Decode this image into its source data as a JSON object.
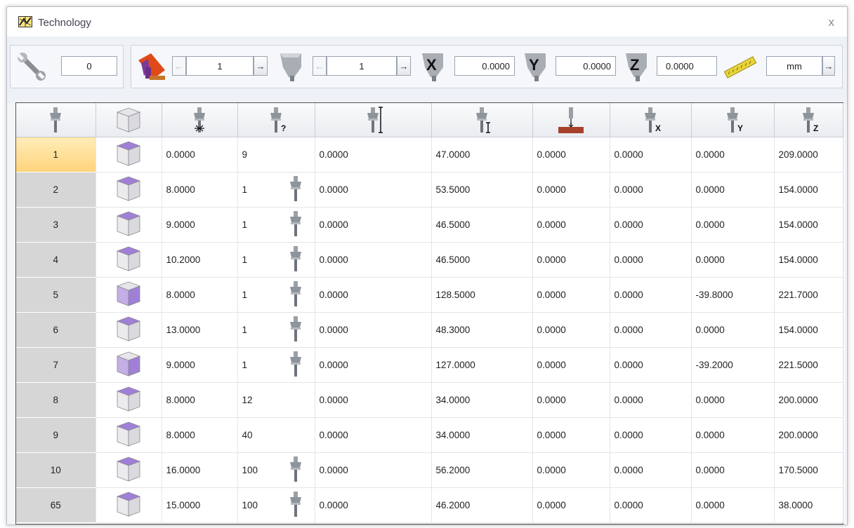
{
  "window": {
    "title": "Technology",
    "close_glyph": "x"
  },
  "toolbar": {
    "tool_number": "0",
    "head_selector": "1",
    "spindle_selector": "1",
    "offset_x": "0.0000",
    "offset_y": "0.0000",
    "offset_z": "0.0000",
    "units": "mm",
    "prev_glyph": "←",
    "next_glyph": "→",
    "axis_x": "X",
    "axis_y": "Y",
    "axis_z": "Z"
  },
  "table": {
    "header_icons": [
      "spindle-icon",
      "cube-icon",
      "tool-diameter-icon",
      "tool-type-icon",
      "tool-length-icon",
      "tool-offset-icon",
      "depth-icon",
      "x-offset-icon",
      "y-offset-icon",
      "z-offset-icon"
    ],
    "header_glyphs": [
      "",
      "",
      "",
      "?",
      "",
      "",
      "",
      "X",
      "Y",
      "Z"
    ],
    "rows": [
      {
        "id": "1",
        "diameter": "0.0000",
        "type": "9",
        "spindle": false,
        "length": "0.0000",
        "offset": "47.0000",
        "depth": "0.0000",
        "x": "0.0000",
        "y": "0.0000",
        "z": "209.0000",
        "face": "top",
        "selected": true
      },
      {
        "id": "2",
        "diameter": "8.0000",
        "type": "1",
        "spindle": true,
        "length": "0.0000",
        "offset": "53.5000",
        "depth": "0.0000",
        "x": "0.0000",
        "y": "0.0000",
        "z": "154.0000",
        "face": "top",
        "selected": false
      },
      {
        "id": "3",
        "diameter": "9.0000",
        "type": "1",
        "spindle": true,
        "length": "0.0000",
        "offset": "46.5000",
        "depth": "0.0000",
        "x": "0.0000",
        "y": "0.0000",
        "z": "154.0000",
        "face": "top",
        "selected": false
      },
      {
        "id": "4",
        "diameter": "10.2000",
        "type": "1",
        "spindle": true,
        "length": "0.0000",
        "offset": "46.5000",
        "depth": "0.0000",
        "x": "0.0000",
        "y": "0.0000",
        "z": "154.0000",
        "face": "top",
        "selected": false
      },
      {
        "id": "5",
        "diameter": "8.0000",
        "type": "1",
        "spindle": true,
        "length": "0.0000",
        "offset": "128.5000",
        "depth": "0.0000",
        "x": "0.0000",
        "y": "-39.8000",
        "z": "221.7000",
        "face": "front",
        "selected": false
      },
      {
        "id": "6",
        "diameter": "13.0000",
        "type": "1",
        "spindle": true,
        "length": "0.0000",
        "offset": "48.3000",
        "depth": "0.0000",
        "x": "0.0000",
        "y": "0.0000",
        "z": "154.0000",
        "face": "top",
        "selected": false
      },
      {
        "id": "7",
        "diameter": "9.0000",
        "type": "1",
        "spindle": true,
        "length": "0.0000",
        "offset": "127.0000",
        "depth": "0.0000",
        "x": "0.0000",
        "y": "-39.2000",
        "z": "221.5000",
        "face": "front",
        "selected": false
      },
      {
        "id": "8",
        "diameter": "8.0000",
        "type": "12",
        "spindle": false,
        "length": "0.0000",
        "offset": "34.0000",
        "depth": "0.0000",
        "x": "0.0000",
        "y": "0.0000",
        "z": "200.0000",
        "face": "top",
        "selected": false
      },
      {
        "id": "9",
        "diameter": "8.0000",
        "type": "40",
        "spindle": false,
        "length": "0.0000",
        "offset": "34.0000",
        "depth": "0.0000",
        "x": "0.0000",
        "y": "0.0000",
        "z": "200.0000",
        "face": "top",
        "selected": false
      },
      {
        "id": "10",
        "diameter": "16.0000",
        "type": "100",
        "spindle": true,
        "length": "0.0000",
        "offset": "56.2000",
        "depth": "0.0000",
        "x": "0.0000",
        "y": "0.0000",
        "z": "170.5000",
        "face": "top",
        "selected": false
      },
      {
        "id": "65",
        "diameter": "15.0000",
        "type": "100",
        "spindle": true,
        "length": "0.0000",
        "offset": "46.2000",
        "depth": "0.0000",
        "x": "0.0000",
        "y": "0.0000",
        "z": "38.0000",
        "face": "top",
        "selected": false
      }
    ]
  },
  "colors": {
    "accent_face": "#a07fd6",
    "selected_row": "#ffd37a",
    "rowhead": "#d6d6d6"
  }
}
